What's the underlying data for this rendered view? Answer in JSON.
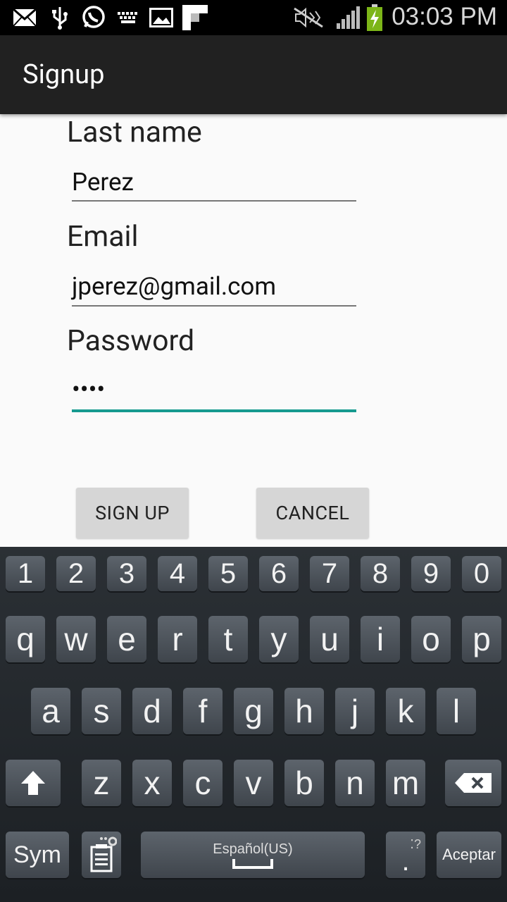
{
  "status_bar": {
    "time": "03:03 PM",
    "icons": [
      "mail-icon",
      "usb-icon",
      "whatsapp-icon",
      "keyboard-icon",
      "image-icon",
      "flipboard-icon",
      "mute-icon",
      "signal-icon",
      "battery-charging-icon"
    ]
  },
  "app_bar": {
    "title": "Signup"
  },
  "form": {
    "last_name_label": "Last name",
    "last_name_value": "Perez",
    "email_label": "Email",
    "email_value": "jperez@gmail.com",
    "password_label": "Password",
    "password_value": "••••"
  },
  "buttons": {
    "signup": "SIGN UP",
    "cancel": "CANCEL"
  },
  "keyboard": {
    "numbers": [
      "1",
      "2",
      "3",
      "4",
      "5",
      "6",
      "7",
      "8",
      "9",
      "0"
    ],
    "row1": [
      "q",
      "w",
      "e",
      "r",
      "t",
      "y",
      "u",
      "i",
      "o",
      "p"
    ],
    "row2": [
      "a",
      "s",
      "d",
      "f",
      "g",
      "h",
      "j",
      "k",
      "l"
    ],
    "row3": [
      "z",
      "x",
      "c",
      "v",
      "b",
      "n",
      "m"
    ],
    "sym": "Sym",
    "space_label": "Español(US)",
    "period": ".",
    "enter": "Aceptar"
  },
  "colors": {
    "accent": "#169a8f",
    "appbar": "#212121",
    "keyboard_bg": "#23282c"
  }
}
